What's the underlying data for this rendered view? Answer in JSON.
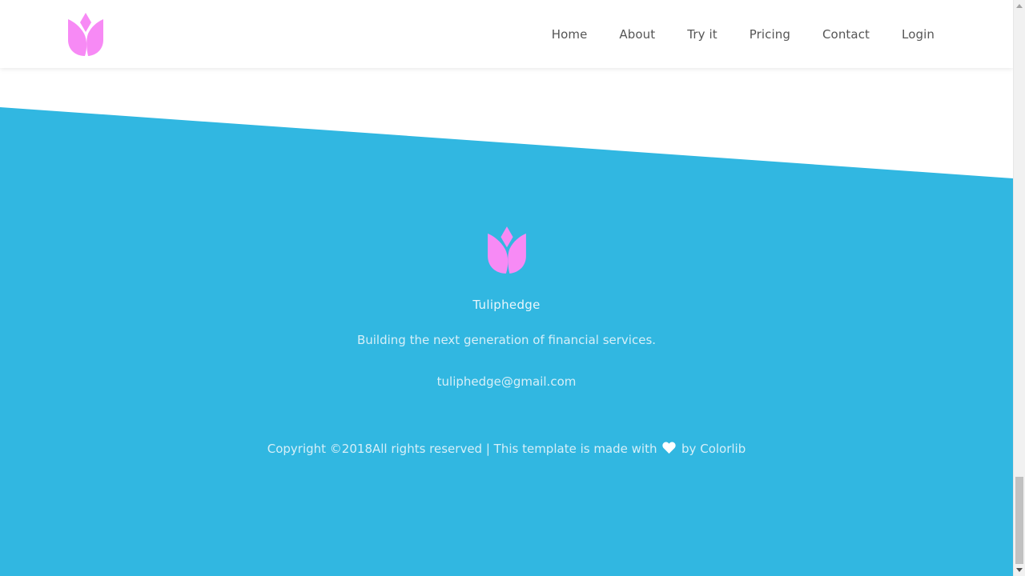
{
  "colors": {
    "footer_bg": "#31b7e1",
    "logo_pink": "#f78af5",
    "nav_text": "#555555"
  },
  "header": {
    "logo_icon": "tulip-logo-icon",
    "nav": [
      {
        "label": "Home"
      },
      {
        "label": "About"
      },
      {
        "label": "Try it"
      },
      {
        "label": "Pricing"
      },
      {
        "label": "Contact"
      },
      {
        "label": "Login"
      }
    ]
  },
  "footer": {
    "logo_icon": "tulip-logo-icon",
    "brand": "Tuliphedge",
    "tagline": "Building the next generation of financial services.",
    "email": "tuliphedge@gmail.com",
    "copyright": {
      "prefix": "Copyright ©2018All rights reserved | This template is made with",
      "heart_icon": "heart-icon",
      "by": "by",
      "link": "Colorlib"
    }
  },
  "scrollbar": {
    "position": 0.83
  }
}
